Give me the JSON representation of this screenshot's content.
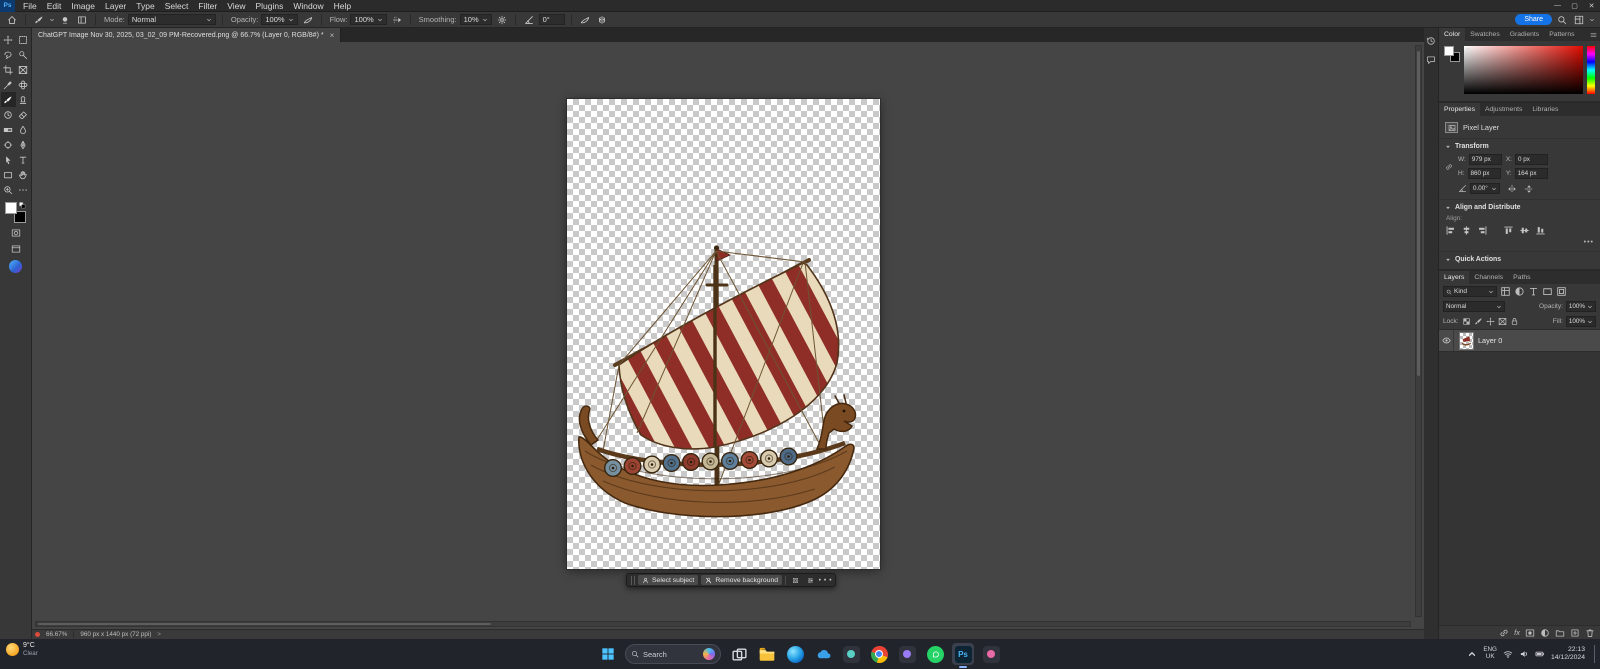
{
  "titlebar": {
    "app": "Ps",
    "menus": [
      "File",
      "Edit",
      "Image",
      "Layer",
      "Type",
      "Select",
      "Filter",
      "View",
      "Plugins",
      "Window",
      "Help"
    ],
    "window_controls": [
      "minimize",
      "maximize",
      "close"
    ]
  },
  "options": {
    "mode_label": "Mode:",
    "mode_value": "Normal",
    "opacity_label": "Opacity:",
    "opacity_value": "100%",
    "flow_label": "Flow:",
    "flow_value": "100%",
    "smoothing_label": "Smoothing:",
    "smoothing_value": "10%",
    "angle_value": "0°",
    "share_label": "Share"
  },
  "doc_tab": {
    "title": "ChatGPT Image Nov 30, 2025, 03_02_09 PM-Recovered.png @ 66.7% (Layer 0, RGB/8#) *",
    "close": "×"
  },
  "tools": [
    {
      "icon": "move"
    },
    {
      "icon": "marquee"
    },
    {
      "icon": "lasso"
    },
    {
      "icon": "quick-select"
    },
    {
      "icon": "crop"
    },
    {
      "icon": "frame"
    },
    {
      "icon": "eyedropper"
    },
    {
      "icon": "healing"
    },
    {
      "icon": "brush",
      "active": true
    },
    {
      "icon": "clone-stamp"
    },
    {
      "icon": "history-brush"
    },
    {
      "icon": "eraser"
    },
    {
      "icon": "gradient"
    },
    {
      "icon": "blur"
    },
    {
      "icon": "dodge"
    },
    {
      "icon": "pen"
    },
    {
      "icon": "path-select"
    },
    {
      "icon": "type"
    },
    {
      "icon": "shape"
    },
    {
      "icon": "hand"
    },
    {
      "icon": "zoom"
    },
    {
      "icon": "ellipsis"
    }
  ],
  "swatches": {
    "foreground": "#ffffff",
    "background": "#000000"
  },
  "ctx_bar": {
    "select_subject": "Select subject",
    "remove_background": "Remove background",
    "more": "···"
  },
  "status": {
    "zoom": "66.67%",
    "doc_info": "960 px x 1440 px (72 ppi)",
    "chevron": ">"
  },
  "color_panel": {
    "tabs": [
      "Color",
      "Swatches",
      "Gradients",
      "Patterns"
    ],
    "active_tab": "Color"
  },
  "properties": {
    "tabs": [
      "Properties",
      "Adjustments",
      "Libraries"
    ],
    "layer_type": "Pixel Layer",
    "transform_header": "Transform",
    "w_label": "W:",
    "w_value": "979 px",
    "x_label": "X:",
    "x_value": "0 px",
    "h_label": "H:",
    "h_value": "860 px",
    "y_label": "Y:",
    "y_value": "164 px",
    "angle_value": "0.00°",
    "align_header": "Align and Distribute",
    "align_label": "Align:",
    "more": "•••",
    "quick_actions_header": "Quick Actions"
  },
  "layers": {
    "tabs": [
      "Layers",
      "Channels",
      "Paths"
    ],
    "filter_value": "Kind",
    "blend_value": "Normal",
    "opacity_label": "Opacity:",
    "opacity_value": "100%",
    "lock_label": "Lock:",
    "fill_label": "Fill:",
    "fill_value": "100%",
    "rows": [
      {
        "name": "Layer 0",
        "visible": true,
        "selected": true
      }
    ]
  },
  "os": {
    "weather_temp": "9°C",
    "weather_cond": "Clear",
    "search": "Search",
    "apps": [
      {
        "name": "task-view"
      },
      {
        "name": "file-explorer"
      },
      {
        "name": "edge"
      },
      {
        "name": "onedrive"
      },
      {
        "name": "app-dark-1"
      },
      {
        "name": "chrome"
      },
      {
        "name": "app-dark-2"
      },
      {
        "name": "whatsapp"
      },
      {
        "name": "photoshop",
        "label": "Ps",
        "active": true
      },
      {
        "name": "app-dark-3"
      }
    ],
    "tray": {
      "lang_top": "ENG",
      "lang_bottom": "UK",
      "time": "22:13",
      "date": "14/12/2024"
    }
  },
  "artwork": {
    "sail_red": "#8f2e26",
    "sail_cream": "#e9dabb",
    "hull": "#8a5a2e",
    "shield_colors": [
      "#76909f",
      "#9c4434",
      "#d8cbae",
      "#51718d",
      "#8e3a2c",
      "#c3b795",
      "#5d7f9b",
      "#a34a38",
      "#d8cbae",
      "#4e6a86"
    ]
  }
}
